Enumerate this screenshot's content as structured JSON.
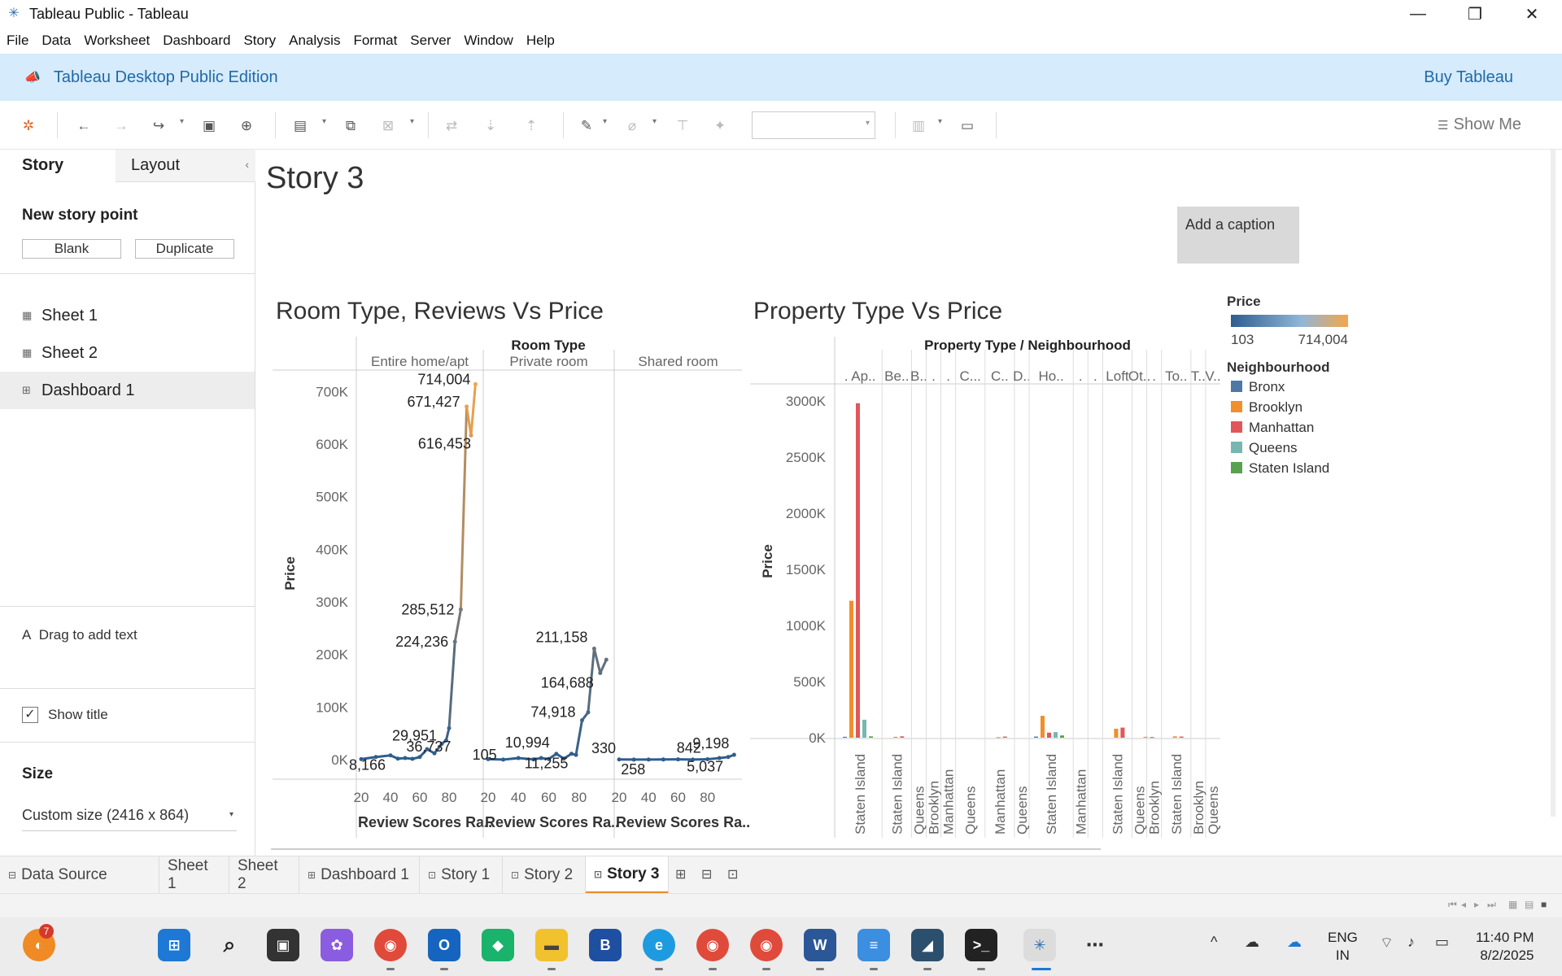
{
  "window": {
    "title": "Tableau Public - Tableau",
    "minimize": "—",
    "restore": "❐",
    "close": "✕"
  },
  "menu": [
    "File",
    "Data",
    "Worksheet",
    "Dashboard",
    "Story",
    "Analysis",
    "Format",
    "Server",
    "Window",
    "Help"
  ],
  "banner": {
    "edition": "Tableau Desktop Public Edition",
    "buy": "Buy Tableau",
    "icon": "megaphone-icon"
  },
  "toolbar": {
    "show_me": "Show Me"
  },
  "left_panel": {
    "tab_story": "Story",
    "tab_layout": "Layout",
    "new_story_point": "New story point",
    "blank": "Blank",
    "duplicate": "Duplicate",
    "sheets": [
      {
        "label": "Sheet 1",
        "icon": "▦"
      },
      {
        "label": "Sheet 2",
        "icon": "▦"
      },
      {
        "label": "Dashboard 1",
        "icon": "⊞"
      }
    ],
    "drag_text": "Drag to add text",
    "drag_text_icon": "A",
    "show_title": "Show title",
    "size_title": "Size",
    "size_value": "Custom size (2416 x 864)"
  },
  "story": {
    "title": "Story 3",
    "caption": "Add a caption"
  },
  "colors": {
    "line_low": "#2e5d8f",
    "line_high": "#f5a54a",
    "Bronx": "#4e79a7",
    "Brooklyn": "#f28e2b",
    "Manhattan": "#e15759",
    "Queens": "#76b7b2",
    "Staten Island": "#59a14f"
  },
  "chart_data": [
    {
      "type": "line",
      "title": "Room Type, Reviews Vs Price",
      "column_header": "Room Type",
      "panes": [
        "Entire home/apt",
        "Private room",
        "Shared room"
      ],
      "xlabel": "Review Scores Ra..",
      "ylabel": "Price",
      "x_ticks": [
        "20",
        "40",
        "60",
        "80"
      ],
      "y_ticks": [
        "0K",
        "100K",
        "200K",
        "300K",
        "400K",
        "500K",
        "600K",
        "700K"
      ],
      "ylim": [
        0,
        730000
      ],
      "xlim": [
        20,
        100
      ],
      "series": [
        {
          "name": "Entire home/apt",
          "points": [
            [
              20,
              1000
            ],
            [
              30,
              5000
            ],
            [
              40,
              8166
            ],
            [
              45,
              2000
            ],
            [
              50,
              3000
            ],
            [
              55,
              1500
            ],
            [
              60,
              5000
            ],
            [
              65,
              20000
            ],
            [
              70,
              12000
            ],
            [
              75,
              29951
            ],
            [
              78,
              36737
            ],
            [
              80,
              60000
            ],
            [
              84,
              224236
            ],
            [
              88,
              285512
            ],
            [
              92,
              671427
            ],
            [
              95,
              616453
            ],
            [
              98,
              714004
            ]
          ]
        },
        {
          "name": "Private room",
          "points": [
            [
              20,
              1000
            ],
            [
              30,
              105
            ],
            [
              40,
              3000
            ],
            [
              50,
              500
            ],
            [
              55,
              3000
            ],
            [
              60,
              1200
            ],
            [
              65,
              10994
            ],
            [
              70,
              2000
            ],
            [
              75,
              11255
            ],
            [
              78,
              9000
            ],
            [
              82,
              74918
            ],
            [
              86,
              90000
            ],
            [
              90,
              211158
            ],
            [
              94,
              164688
            ],
            [
              98,
              190000
            ]
          ]
        },
        {
          "name": "Shared room",
          "points": [
            [
              20,
              330
            ],
            [
              30,
              100
            ],
            [
              40,
              258
            ],
            [
              50,
              300
            ],
            [
              60,
              500
            ],
            [
              70,
              200
            ],
            [
              80,
              842
            ],
            [
              88,
              3000
            ],
            [
              94,
              5037
            ],
            [
              98,
              9198
            ]
          ]
        }
      ],
      "labels": [
        {
          "text": "714,004",
          "pane": 0,
          "x": 98,
          "y": 714004
        },
        {
          "text": "671,427",
          "pane": 0,
          "x": 92,
          "y": 671427
        },
        {
          "text": "616,453",
          "pane": 0,
          "x": 95,
          "y": 616453
        },
        {
          "text": "285,512",
          "pane": 0,
          "x": 88,
          "y": 285512
        },
        {
          "text": "224,236",
          "pane": 0,
          "x": 84,
          "y": 224236
        },
        {
          "text": "29,951",
          "pane": 0,
          "x": 75,
          "y": 29951
        },
        {
          "text": "36,737",
          "pane": 0,
          "x": 78,
          "y": 36737
        },
        {
          "text": "8,166",
          "pane": 0,
          "x": 40,
          "y": 8166
        },
        {
          "text": "105",
          "pane": 1,
          "x": 30,
          "y": 105
        },
        {
          "text": "10,994",
          "pane": 1,
          "x": 65,
          "y": 10994
        },
        {
          "text": "11,255",
          "pane": 1,
          "x": 75,
          "y": 11255
        },
        {
          "text": "74,918",
          "pane": 1,
          "x": 82,
          "y": 74918
        },
        {
          "text": "164,688",
          "pane": 1,
          "x": 94,
          "y": 164688
        },
        {
          "text": "211,158",
          "pane": 1,
          "x": 90,
          "y": 211158
        },
        {
          "text": "330",
          "pane": 2,
          "x": 20,
          "y": 330
        },
        {
          "text": "258",
          "pane": 2,
          "x": 40,
          "y": 258
        },
        {
          "text": "842",
          "pane": 2,
          "x": 80,
          "y": 842
        },
        {
          "text": "5,037",
          "pane": 2,
          "x": 94,
          "y": 5037
        },
        {
          "text": "9,198",
          "pane": 2,
          "x": 98,
          "y": 9198
        }
      ]
    },
    {
      "type": "bar",
      "title": "Property Type Vs Price",
      "column_header": "Property Type  /  Neighbourhood",
      "ylabel": "Price",
      "y_ticks": [
        "0K",
        "500K",
        "1000K",
        "1500K",
        "2000K",
        "2500K",
        "3000K"
      ],
      "ylim": [
        0,
        3100000
      ],
      "property_types": [
        ". Ap..",
        "Be..",
        "B..",
        ".",
        ".",
        "C...",
        "C..",
        "D..",
        "Ho..",
        ".",
        ".",
        "Loft",
        "Ot..",
        ".",
        "To..",
        "T..",
        "V.."
      ],
      "property_type_weights": [
        3,
        2,
        1,
        1,
        1,
        2,
        2,
        1,
        3,
        1,
        1,
        2,
        1,
        1,
        2,
        1,
        1
      ],
      "neighbourhood_labels": [
        {
          "text": "Staten Island",
          "pt": 0
        },
        {
          "text": "Staten Island",
          "pt": 1
        },
        {
          "text": "Queens",
          "pt": 2
        },
        {
          "text": "Brooklyn",
          "pt": 3
        },
        {
          "text": "Manhattan",
          "pt": 4
        },
        {
          "text": "Queens",
          "pt": 5
        },
        {
          "text": "Manhattan",
          "pt": 6
        },
        {
          "text": "Queens",
          "pt": 7
        },
        {
          "text": "Staten Island",
          "pt": 8
        },
        {
          "text": "Manhattan",
          "pt": 9
        },
        {
          "text": "Staten Island",
          "pt": 11
        },
        {
          "text": "Queens",
          "pt": 12
        },
        {
          "text": "Brooklyn",
          "pt": 13
        },
        {
          "text": "Staten Island",
          "pt": 14
        },
        {
          "text": "Brooklyn",
          "pt": 15
        },
        {
          "text": "Queens",
          "pt": 16
        }
      ],
      "bars": [
        {
          "pt": 0,
          "neighbourhood": "Bronx",
          "value": 8000
        },
        {
          "pt": 0,
          "neighbourhood": "Brooklyn",
          "value": 1220000
        },
        {
          "pt": 0,
          "neighbourhood": "Manhattan",
          "value": 2980000
        },
        {
          "pt": 0,
          "neighbourhood": "Queens",
          "value": 160000
        },
        {
          "pt": 0,
          "neighbourhood": "Staten Island",
          "value": 12000
        },
        {
          "pt": 1,
          "neighbourhood": "Brooklyn",
          "value": 8000
        },
        {
          "pt": 1,
          "neighbourhood": "Manhattan",
          "value": 12000
        },
        {
          "pt": 6,
          "neighbourhood": "Brooklyn",
          "value": 5000
        },
        {
          "pt": 6,
          "neighbourhood": "Manhattan",
          "value": 10000
        },
        {
          "pt": 8,
          "neighbourhood": "Bronx",
          "value": 10000
        },
        {
          "pt": 8,
          "neighbourhood": "Brooklyn",
          "value": 195000
        },
        {
          "pt": 8,
          "neighbourhood": "Manhattan",
          "value": 45000
        },
        {
          "pt": 8,
          "neighbourhood": "Queens",
          "value": 50000
        },
        {
          "pt": 8,
          "neighbourhood": "Staten Island",
          "value": 20000
        },
        {
          "pt": 11,
          "neighbourhood": "Brooklyn",
          "value": 80000
        },
        {
          "pt": 11,
          "neighbourhood": "Manhattan",
          "value": 90000
        },
        {
          "pt": 12,
          "neighbourhood": "Brooklyn",
          "value": 8000
        },
        {
          "pt": 12,
          "neighbourhood": "Manhattan",
          "value": 6000
        },
        {
          "pt": 14,
          "neighbourhood": "Brooklyn",
          "value": 12000
        },
        {
          "pt": 14,
          "neighbourhood": "Manhattan",
          "value": 10000
        }
      ],
      "legend": {
        "price_title": "Price",
        "price_min": "103",
        "price_max": "714,004",
        "neighbourhood_title": "Neighbourhood",
        "items": [
          "Bronx",
          "Brooklyn",
          "Manhattan",
          "Queens",
          "Staten Island"
        ]
      }
    }
  ],
  "sheet_tabs": [
    {
      "label": "Data Source",
      "icon": "⊟"
    },
    {
      "label": "Sheet 1",
      "icon": ""
    },
    {
      "label": "Sheet 2",
      "icon": ""
    },
    {
      "label": "Dashboard 1",
      "icon": "⊞"
    },
    {
      "label": "Story 1",
      "icon": "⊡"
    },
    {
      "label": "Story 2",
      "icon": "⊡"
    },
    {
      "label": "Story 3",
      "icon": "⊡"
    }
  ],
  "taskbar": {
    "badge_count": "7",
    "lang_line1": "ENG",
    "lang_line2": "IN",
    "time": "11:40 PM",
    "date": "8/2/2025"
  }
}
